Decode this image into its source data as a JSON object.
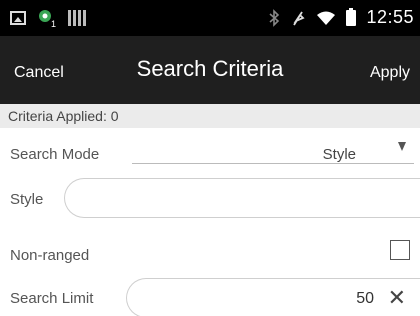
{
  "status_bar": {
    "time": "12:55",
    "left_icons": [
      "image-icon",
      "app-notification-icon",
      "barcode-icon"
    ],
    "right_icons": [
      "bluetooth-icon",
      "mute-icon",
      "wifi-icon",
      "battery-charging-icon"
    ]
  },
  "header": {
    "cancel_label": "Cancel",
    "title": "Search Criteria",
    "apply_label": "Apply"
  },
  "criteria_applied": "Criteria Applied: 0",
  "form": {
    "search_mode_label": "Search Mode",
    "search_mode_value": "Style",
    "style_label": "Style",
    "style_value": "",
    "non_ranged_label": "Non-ranged",
    "non_ranged_checked": false,
    "search_limit_label": "Search Limit",
    "search_limit_value": "50",
    "clear_icon": "close-icon"
  },
  "colors": {
    "status_bar_bg": "#000000",
    "header_bg": "#1f1f1f",
    "criteria_bar_bg": "#ebebeb"
  }
}
